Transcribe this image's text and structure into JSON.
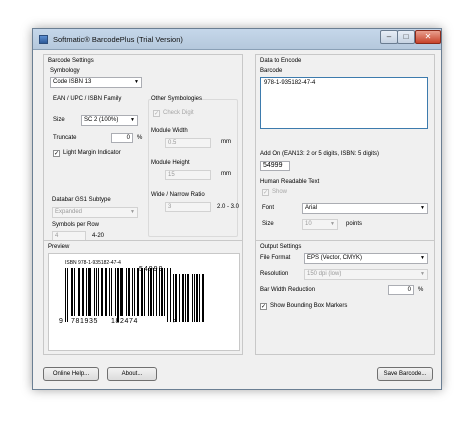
{
  "window": {
    "title": "Softmatic® BarcodePlus (Trial Version)"
  },
  "barcode_settings": {
    "group_title": "Barcode Settings",
    "symbology_label": "Symbology",
    "symbology_value": "Code ISBN 13",
    "ean_group": {
      "title": "EAN / UPC / ISBN Family",
      "size_label": "Size",
      "size_value": "SC 2 (100%)",
      "truncate_label": "Truncate",
      "truncate_value": "0",
      "truncate_unit": "%",
      "light_margin_label": "Light Margin Indicator",
      "light_margin_checked": true
    },
    "databar_group": {
      "title": "Databar GS1 Subtype",
      "subtype_value": "Expanded",
      "symbols_per_row_label": "Symbols per Row",
      "symbols_per_row_value": "4",
      "symbols_range": "4-20"
    },
    "other_group": {
      "title": "Other Symbologies",
      "check_digit_label": "Check Digit",
      "module_width_label": "Module Width",
      "module_width_value": "0.5",
      "module_width_unit": "mm",
      "module_height_label": "Module Height",
      "module_height_value": "15",
      "module_height_unit": "mm",
      "ratio_label": "Wide / Narrow Ratio",
      "ratio_value": "3",
      "ratio_range": "2.0 - 3.0"
    }
  },
  "data_to_encode": {
    "group_title": "Data to Encode",
    "barcode_label": "Barcode",
    "barcode_value": "978-1-935182-47-4",
    "addon_label": "Add On (EAN13: 2 or 5 digits, ISBN: 5 digits)",
    "addon_value": "54999"
  },
  "human_readable": {
    "group_title": "Human Readable Text",
    "show_label": "Show",
    "font_label": "Font",
    "font_value": "Arial",
    "size_label": "Size",
    "size_value": "10",
    "size_unit": "points"
  },
  "preview": {
    "group_title": "Preview",
    "isbn_text": "ISBN 978-1-935182-47-4",
    "addon_text": "54999",
    "digits_left": "9",
    "digits_mid1": "781935",
    "digits_mid2": "182474",
    "quiet_mark": ">"
  },
  "output_settings": {
    "group_title": "Output Settings",
    "file_format_label": "File Format",
    "file_format_value": "EPS (Vector, CMYK)",
    "resolution_label": "Resolution",
    "resolution_value": "150 dpi (low)",
    "bwr_label": "Bar Width Reduction",
    "bwr_value": "0",
    "bwr_unit": "%",
    "bounding_box_label": "Show Bounding Box Markers",
    "bounding_box_checked": true
  },
  "buttons": {
    "online_help": "Online Help...",
    "about": "About...",
    "save_barcode": "Save Barcode..."
  }
}
